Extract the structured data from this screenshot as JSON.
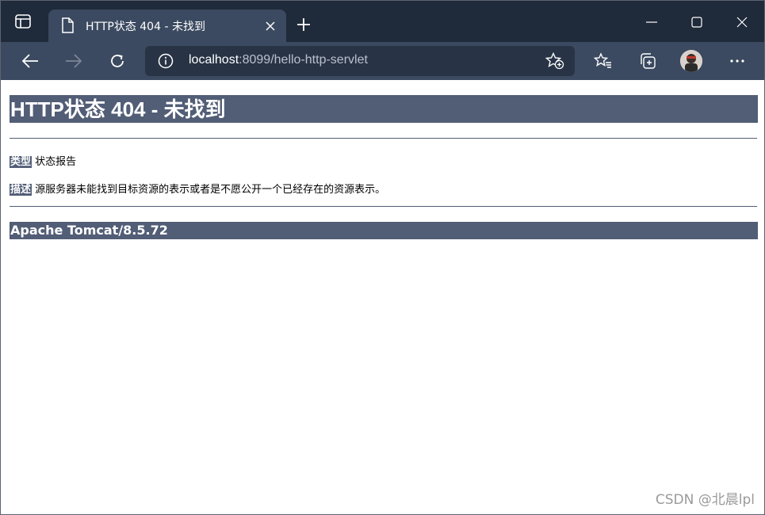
{
  "browser": {
    "tab": {
      "title": "HTTP状态 404 - 未找到"
    },
    "address": {
      "host": "localhost",
      "rest": ":8099/hello-http-servlet"
    }
  },
  "page": {
    "heading": "HTTP状态 404 - 未找到",
    "type_label": "类型",
    "type_value": "状态报告",
    "desc_label": "描述",
    "desc_value": "源服务器未能找到目标资源的表示或者是不愿公开一个已经存在的资源表示。",
    "server_info": "Apache Tomcat/8.5.72"
  },
  "watermark": "CSDN @北晨lpl",
  "colors": {
    "tabbar_bg": "#1f2a3a",
    "toolbar_bg": "#3b4a60",
    "tomcat_header": "#525d76"
  },
  "icons": [
    "tab-actions-icon",
    "document-icon",
    "close-icon",
    "plus-icon",
    "minimize-icon",
    "maximize-icon",
    "window-close-icon",
    "back-arrow-icon",
    "forward-arrow-icon",
    "refresh-icon",
    "info-icon",
    "add-favorite-icon",
    "favorites-icon",
    "collections-icon",
    "avatar",
    "more-icon"
  ]
}
